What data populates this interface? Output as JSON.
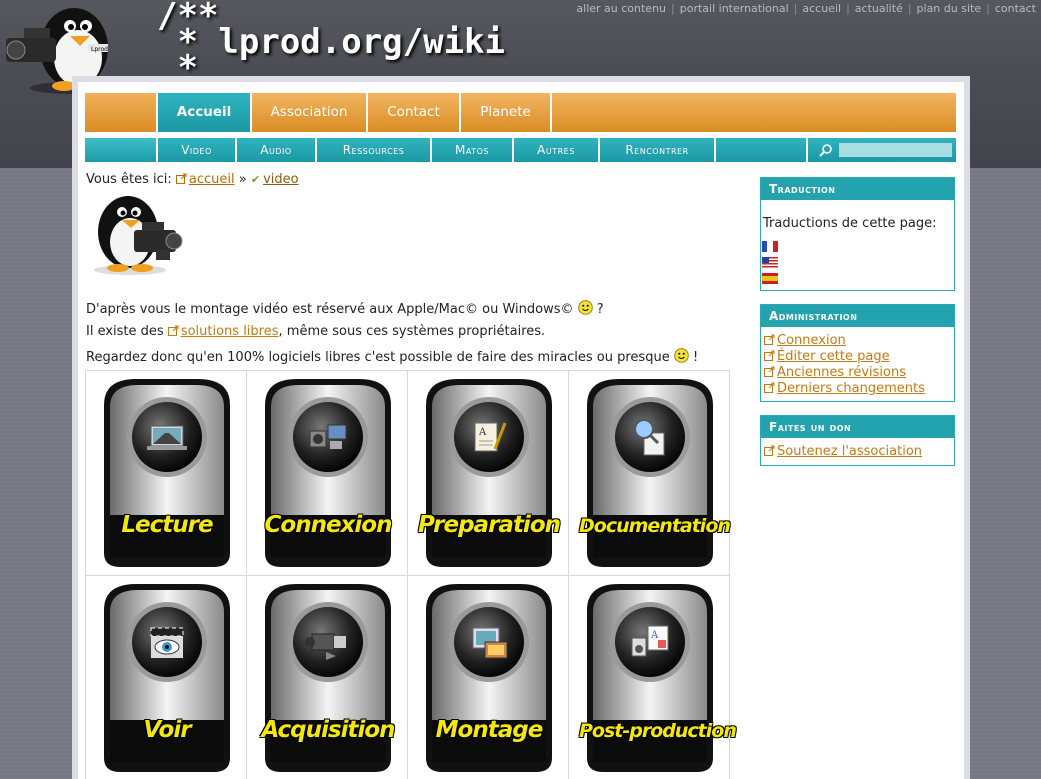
{
  "top_links": [
    "aller au contenu",
    "portail international",
    "accueil",
    "actualité",
    "plan du site",
    "contact"
  ],
  "site_title": {
    "line1": "/**",
    "line2": " * lprod.org/wiki",
    "line3": " *"
  },
  "nav_primary": [
    {
      "label": "Accueil",
      "active": true
    },
    {
      "label": "Association",
      "active": false
    },
    {
      "label": "Contact",
      "active": false
    },
    {
      "label": "Planete",
      "active": false
    }
  ],
  "nav_secondary": [
    "Video",
    "Audio",
    "Ressources",
    "Matos",
    "Autres",
    "Rencontrer"
  ],
  "search": {
    "placeholder": "",
    "icon": "magnifier-icon"
  },
  "breadcrumb": {
    "prefix": "Vous êtes ici:",
    "home": "accueil",
    "separator": "»",
    "current": "video"
  },
  "content": {
    "p1_before": "D'après vous le montage vidéo est réservé aux Apple/Mac© ou Windows©",
    "p1_after": " ?",
    "p2_before": "Il existe des ",
    "p2_link": "solutions libres",
    "p2_after": ", même sous ces systèmes propriétaires.",
    "p3_before": "Regardez donc qu'en 100% logiciels libres c'est possible de faire des miracles ou presque",
    "p3_after": " !"
  },
  "grid": [
    {
      "label": "Lecture",
      "icon": "road-laptop-icon"
    },
    {
      "label": "Connexion",
      "icon": "devices-icon"
    },
    {
      "label": "Preparation",
      "icon": "document-pen-icon"
    },
    {
      "label": "Documentation",
      "icon": "magnifier-document-icon"
    },
    {
      "label": "Voir",
      "icon": "eye-clapper-icon"
    },
    {
      "label": "Acquisition",
      "icon": "camcorder-icon"
    },
    {
      "label": "Montage",
      "icon": "film-photo-icon"
    },
    {
      "label": "Post-production",
      "icon": "speaker-text-icon"
    }
  ],
  "sidebar": {
    "traduction": {
      "title": "Traduction",
      "text": "Traductions de cette page:",
      "flags": [
        "fr",
        "us",
        "es"
      ]
    },
    "administration": {
      "title": "Administration",
      "links": [
        "Connexion",
        "Éditer cette page",
        "Anciennes révisions",
        "Derniers changements"
      ]
    },
    "don": {
      "title": "Faites un don",
      "links": [
        "Soutenez l'association"
      ]
    }
  },
  "colors": {
    "orange": "#e0962e",
    "teal": "#23a3ad",
    "link": "#c27a14",
    "badge_text": "#f4e70c"
  }
}
